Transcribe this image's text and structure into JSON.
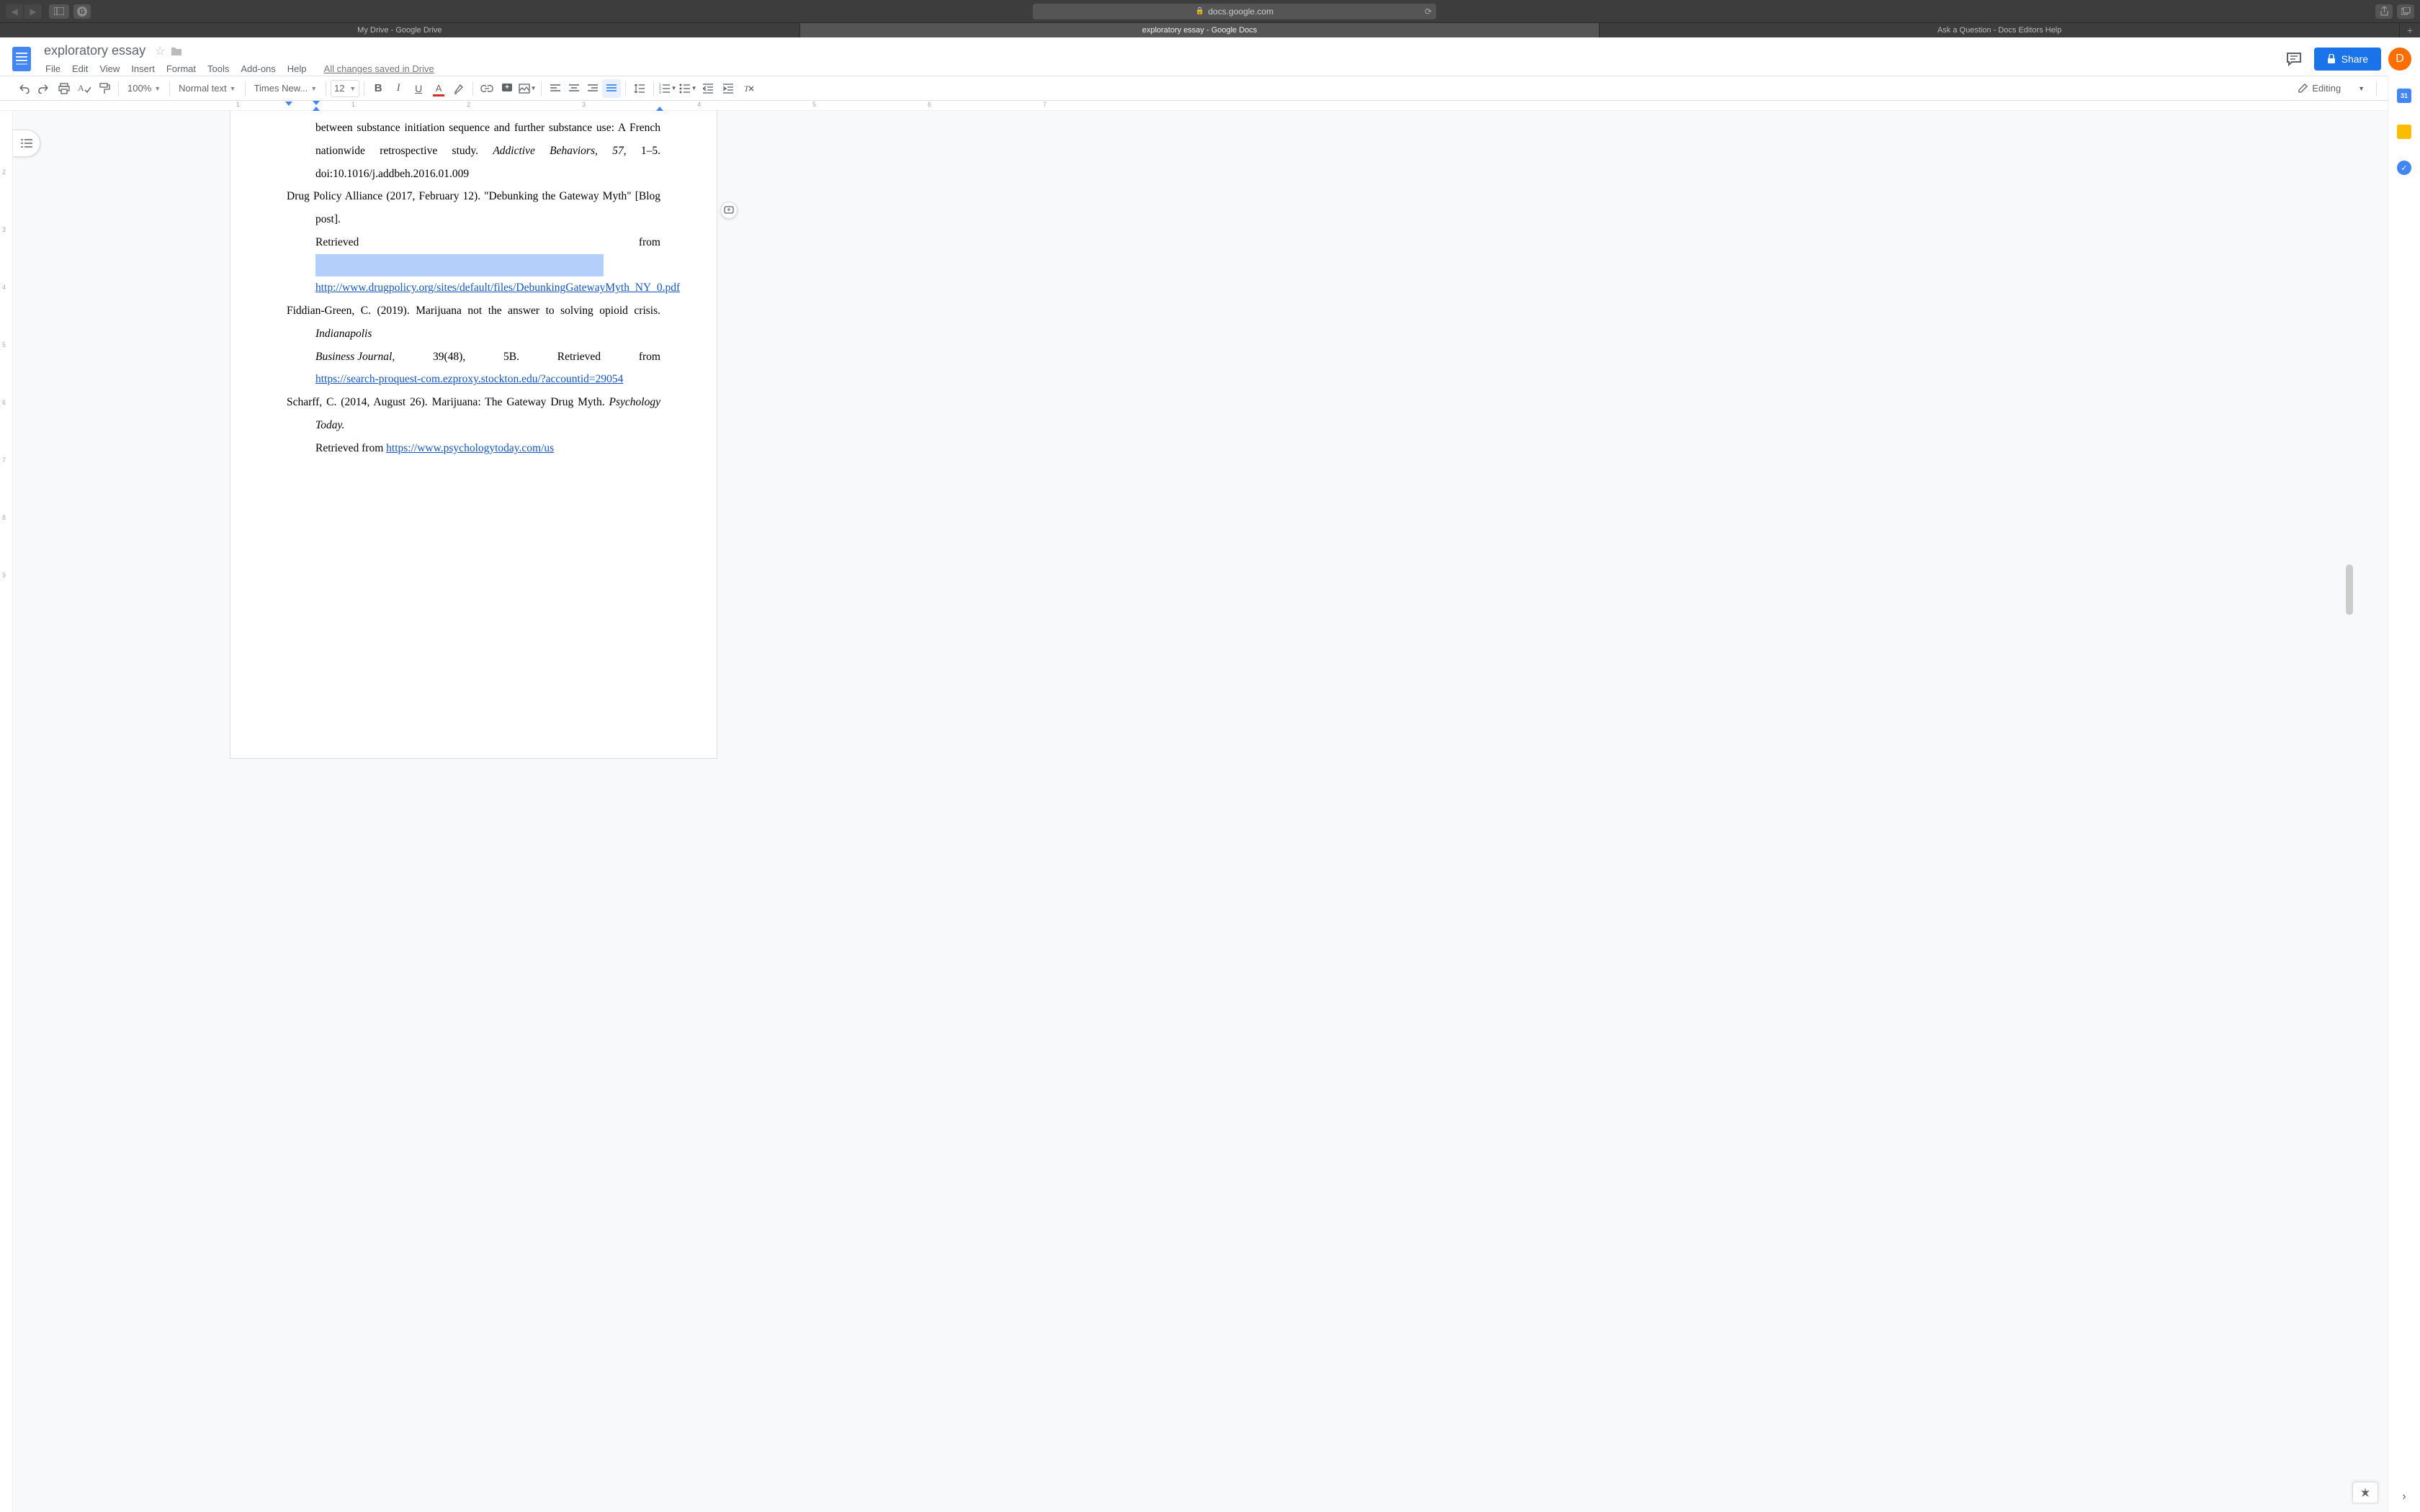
{
  "browser": {
    "url": "docs.google.com",
    "tabs": [
      {
        "label": "My Drive - Google Drive",
        "active": false
      },
      {
        "label": "exploratory essay - Google Docs",
        "active": true
      },
      {
        "label": "Ask a Question - Docs Editors Help",
        "active": false
      }
    ]
  },
  "docs": {
    "title": "exploratory essay",
    "menus": [
      "File",
      "Edit",
      "View",
      "Insert",
      "Format",
      "Tools",
      "Add-ons",
      "Help"
    ],
    "save_status": "All changes saved in Drive",
    "share_label": "Share",
    "avatar_letter": "D"
  },
  "toolbar": {
    "zoom": "100%",
    "style": "Normal text",
    "font": "Times New...",
    "font_size": "12",
    "editing_label": "Editing"
  },
  "ruler_nums": [
    "1",
    "",
    "1",
    "",
    "2",
    "",
    "3",
    "",
    "4",
    "",
    "5",
    "",
    "6",
    "",
    "7",
    ""
  ],
  "left_ruler": [
    "",
    "",
    "2",
    "",
    "3",
    "",
    "4",
    "",
    "5",
    "",
    "6",
    "",
    "7",
    "",
    "8",
    "",
    "9"
  ],
  "document": {
    "ref1_line1": "between substance initiation sequence and further substance use: A French nationwide",
    "ref1_line2a": "retrospective study. ",
    "ref1_italic": "Addictive Behaviors",
    "ref1_line2b": ", ",
    "ref1_vol": "57",
    "ref1_line2c": ", 1–5. doi:10.1016/j.addbeh.2016.01.009",
    "ref2_line1": "Drug Policy Alliance (2017, February 12). \"Debunking the Gateway Myth\" [Blog post].",
    "ref2_retrieved": "Retrieved",
    "ref2_from": "from",
    "ref2_link": "http://www.drugpolicy.org/sites/default/files/DebunkingGatewayMyth_NY_0.pdf",
    "ref3_line1a": "Fiddian-Green, C. (2019). Marijuana not the answer to solving opioid crisis. ",
    "ref3_italic1": "Indianapolis",
    "ref3_italic2": "Business Journal,",
    "ref3_line2a": " 39(48), 5B. Retrieved from",
    "ref3_link": "https://search-proquest-com.ezproxy.stockton.edu/?accountid=29054",
    "ref4_line1a": "Scharff, C. (2014, August 26). Marijuana: The Gateway Drug Myth. ",
    "ref4_italic": "Psychology Today.",
    "ref4_line2a": "Retrieved from ",
    "ref4_link": "https://www.psychologytoday.com/us"
  }
}
